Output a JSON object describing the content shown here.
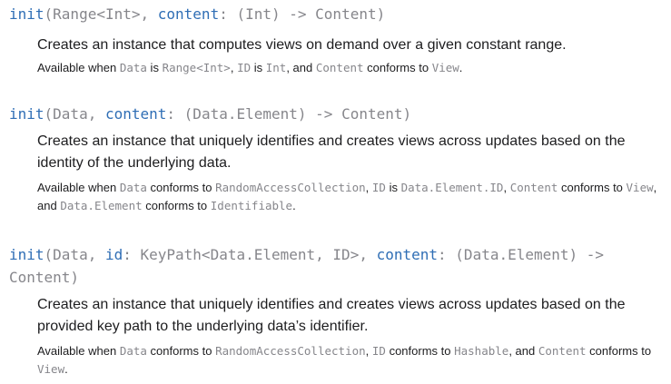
{
  "entries": [
    {
      "sig": {
        "kw": "init",
        "p1": "(Range<Int>, ",
        "lbl": "content",
        "p2": ": (Int) -> Content)"
      },
      "abstract": "Creates an instance that computes views on demand over a given constant range.",
      "avail": [
        "Available when ",
        "Data",
        " is ",
        "Range<Int>",
        ", ",
        "ID",
        " is ",
        "Int",
        ", and ",
        "Content",
        " conforms to ",
        "View",
        "."
      ]
    },
    {
      "sig": {
        "kw": "init",
        "p1": "(Data, ",
        "lbl": "content",
        "p2": ": (Data.Element) -> Content)"
      },
      "abstract": "Creates an instance that uniquely identifies and creates views across updates based on the identity of the underlying data.",
      "avail": [
        "Available when ",
        "Data",
        " conforms to ",
        "RandomAccessCollection",
        ", ",
        "ID",
        " is ",
        "Data.Element.ID",
        ", ",
        "Content",
        " conforms to ",
        "View",
        ", and ",
        "Data.Element",
        " conforms to ",
        "Identifiable",
        "."
      ]
    },
    {
      "sig": {
        "kw": "init",
        "p1": "(Data, ",
        "lbl": "id",
        "p2": ": KeyPath<Data.Element, ID>, ",
        "lbl2": "content",
        "p3": ": (Data.Element) -> Content)"
      },
      "abstract": "Creates an instance that uniquely identifies and creates views across updates based on the provided key path to the underlying data’s identifier.",
      "avail": [
        "Available when ",
        "Data",
        " conforms to ",
        "RandomAccessCollection",
        ", ",
        "ID",
        " conforms to ",
        "Hashable",
        ", and ",
        "Content",
        " conforms to ",
        "View",
        "."
      ]
    }
  ]
}
